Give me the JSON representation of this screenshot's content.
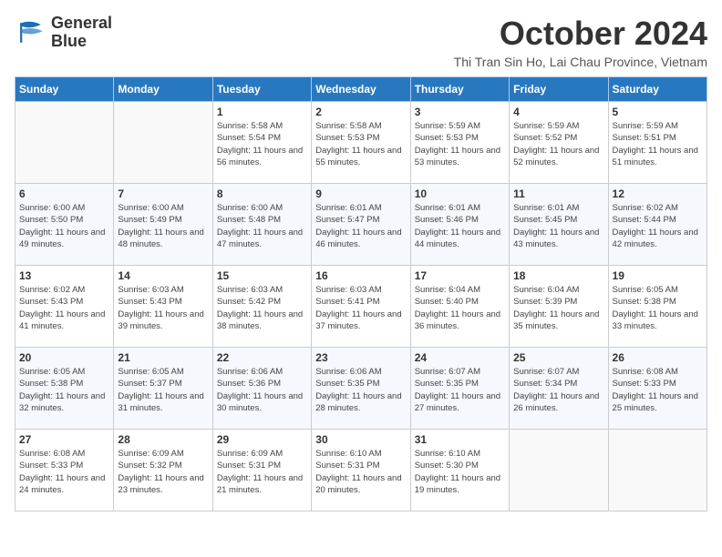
{
  "header": {
    "logo_line1": "General",
    "logo_line2": "Blue",
    "month_title": "October 2024",
    "subtitle": "Thi Tran Sin Ho, Lai Chau Province, Vietnam"
  },
  "days_of_week": [
    "Sunday",
    "Monday",
    "Tuesday",
    "Wednesday",
    "Thursday",
    "Friday",
    "Saturday"
  ],
  "weeks": [
    [
      {
        "day": "",
        "info": ""
      },
      {
        "day": "",
        "info": ""
      },
      {
        "day": "1",
        "info": "Sunrise: 5:58 AM\nSunset: 5:54 PM\nDaylight: 11 hours and 56 minutes."
      },
      {
        "day": "2",
        "info": "Sunrise: 5:58 AM\nSunset: 5:53 PM\nDaylight: 11 hours and 55 minutes."
      },
      {
        "day": "3",
        "info": "Sunrise: 5:59 AM\nSunset: 5:53 PM\nDaylight: 11 hours and 53 minutes."
      },
      {
        "day": "4",
        "info": "Sunrise: 5:59 AM\nSunset: 5:52 PM\nDaylight: 11 hours and 52 minutes."
      },
      {
        "day": "5",
        "info": "Sunrise: 5:59 AM\nSunset: 5:51 PM\nDaylight: 11 hours and 51 minutes."
      }
    ],
    [
      {
        "day": "6",
        "info": "Sunrise: 6:00 AM\nSunset: 5:50 PM\nDaylight: 11 hours and 49 minutes."
      },
      {
        "day": "7",
        "info": "Sunrise: 6:00 AM\nSunset: 5:49 PM\nDaylight: 11 hours and 48 minutes."
      },
      {
        "day": "8",
        "info": "Sunrise: 6:00 AM\nSunset: 5:48 PM\nDaylight: 11 hours and 47 minutes."
      },
      {
        "day": "9",
        "info": "Sunrise: 6:01 AM\nSunset: 5:47 PM\nDaylight: 11 hours and 46 minutes."
      },
      {
        "day": "10",
        "info": "Sunrise: 6:01 AM\nSunset: 5:46 PM\nDaylight: 11 hours and 44 minutes."
      },
      {
        "day": "11",
        "info": "Sunrise: 6:01 AM\nSunset: 5:45 PM\nDaylight: 11 hours and 43 minutes."
      },
      {
        "day": "12",
        "info": "Sunrise: 6:02 AM\nSunset: 5:44 PM\nDaylight: 11 hours and 42 minutes."
      }
    ],
    [
      {
        "day": "13",
        "info": "Sunrise: 6:02 AM\nSunset: 5:43 PM\nDaylight: 11 hours and 41 minutes."
      },
      {
        "day": "14",
        "info": "Sunrise: 6:03 AM\nSunset: 5:43 PM\nDaylight: 11 hours and 39 minutes."
      },
      {
        "day": "15",
        "info": "Sunrise: 6:03 AM\nSunset: 5:42 PM\nDaylight: 11 hours and 38 minutes."
      },
      {
        "day": "16",
        "info": "Sunrise: 6:03 AM\nSunset: 5:41 PM\nDaylight: 11 hours and 37 minutes."
      },
      {
        "day": "17",
        "info": "Sunrise: 6:04 AM\nSunset: 5:40 PM\nDaylight: 11 hours and 36 minutes."
      },
      {
        "day": "18",
        "info": "Sunrise: 6:04 AM\nSunset: 5:39 PM\nDaylight: 11 hours and 35 minutes."
      },
      {
        "day": "19",
        "info": "Sunrise: 6:05 AM\nSunset: 5:38 PM\nDaylight: 11 hours and 33 minutes."
      }
    ],
    [
      {
        "day": "20",
        "info": "Sunrise: 6:05 AM\nSunset: 5:38 PM\nDaylight: 11 hours and 32 minutes."
      },
      {
        "day": "21",
        "info": "Sunrise: 6:05 AM\nSunset: 5:37 PM\nDaylight: 11 hours and 31 minutes."
      },
      {
        "day": "22",
        "info": "Sunrise: 6:06 AM\nSunset: 5:36 PM\nDaylight: 11 hours and 30 minutes."
      },
      {
        "day": "23",
        "info": "Sunrise: 6:06 AM\nSunset: 5:35 PM\nDaylight: 11 hours and 28 minutes."
      },
      {
        "day": "24",
        "info": "Sunrise: 6:07 AM\nSunset: 5:35 PM\nDaylight: 11 hours and 27 minutes."
      },
      {
        "day": "25",
        "info": "Sunrise: 6:07 AM\nSunset: 5:34 PM\nDaylight: 11 hours and 26 minutes."
      },
      {
        "day": "26",
        "info": "Sunrise: 6:08 AM\nSunset: 5:33 PM\nDaylight: 11 hours and 25 minutes."
      }
    ],
    [
      {
        "day": "27",
        "info": "Sunrise: 6:08 AM\nSunset: 5:33 PM\nDaylight: 11 hours and 24 minutes."
      },
      {
        "day": "28",
        "info": "Sunrise: 6:09 AM\nSunset: 5:32 PM\nDaylight: 11 hours and 23 minutes."
      },
      {
        "day": "29",
        "info": "Sunrise: 6:09 AM\nSunset: 5:31 PM\nDaylight: 11 hours and 21 minutes."
      },
      {
        "day": "30",
        "info": "Sunrise: 6:10 AM\nSunset: 5:31 PM\nDaylight: 11 hours and 20 minutes."
      },
      {
        "day": "31",
        "info": "Sunrise: 6:10 AM\nSunset: 5:30 PM\nDaylight: 11 hours and 19 minutes."
      },
      {
        "day": "",
        "info": ""
      },
      {
        "day": "",
        "info": ""
      }
    ]
  ]
}
